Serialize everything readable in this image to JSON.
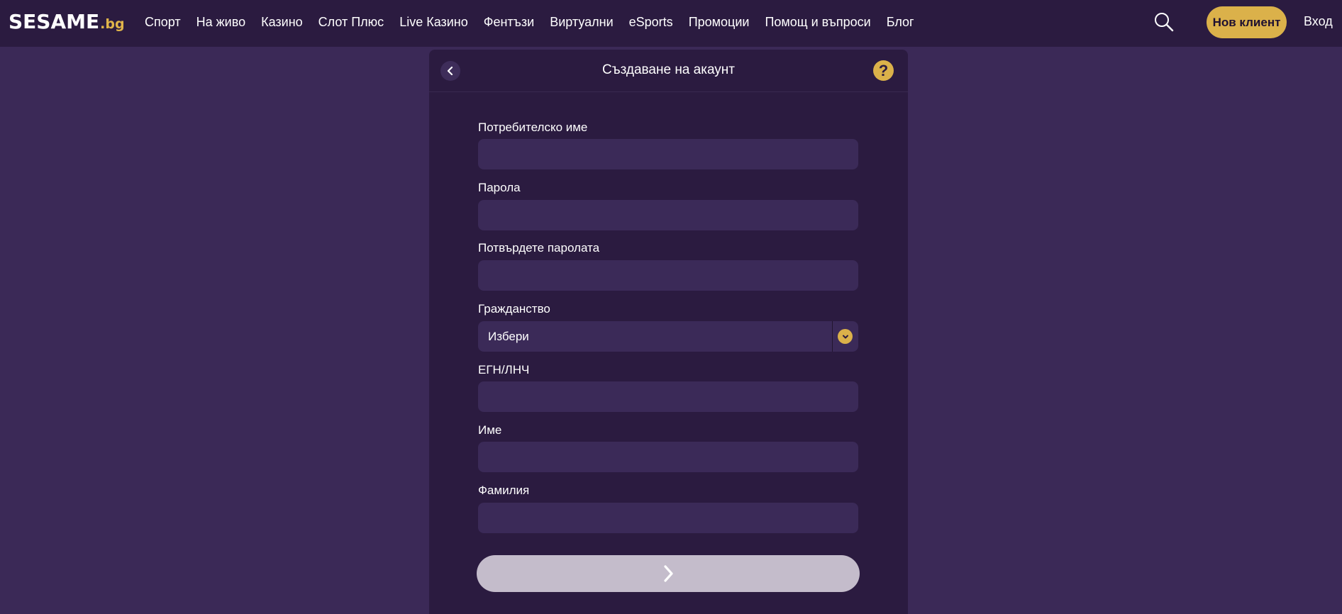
{
  "header": {
    "logo_main": "SESAME",
    "logo_tld": ".bg",
    "nav": [
      "Спорт",
      "На живо",
      "Казино",
      "Слот Плюс",
      "Live Казино",
      "Фентъзи",
      "Виртуални",
      "eSports",
      "Промоции",
      "Помощ и въпроси",
      "Блог"
    ],
    "search_icon": "search-icon",
    "new_client_label": "Нов клиент",
    "login_label": "Вход"
  },
  "form": {
    "title": "Създаване на акаунт",
    "help_symbol": "?",
    "fields": {
      "username": {
        "label": "Потребителско име",
        "value": ""
      },
      "password": {
        "label": "Парола",
        "value": ""
      },
      "confirm_password": {
        "label": "Потвърдете паролата",
        "value": ""
      },
      "citizenship": {
        "label": "Гражданство",
        "selected": "Избери"
      },
      "egn": {
        "label": "ЕГН/ЛНЧ",
        "value": ""
      },
      "first_name": {
        "label": "Име",
        "value": ""
      },
      "last_name": {
        "label": "Фамилия",
        "value": ""
      }
    },
    "submit_icon": "chevron-right-icon"
  },
  "colors": {
    "page_bg": "#3b2957",
    "topbar_bg": "#2b1b40",
    "panel_bg": "#2b1b40",
    "input_bg": "#3b2a58",
    "accent": "#dbb14a",
    "submit_disabled": "#c4bccb"
  }
}
